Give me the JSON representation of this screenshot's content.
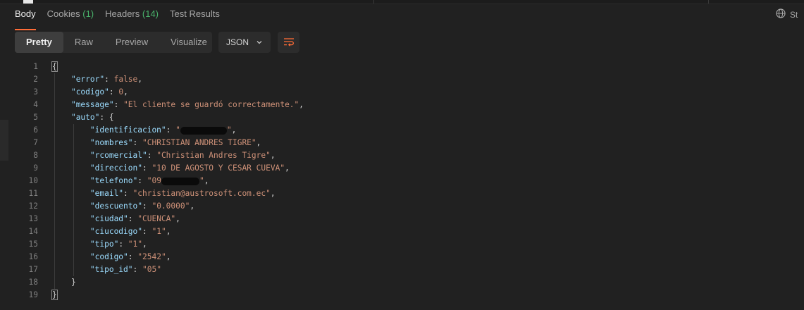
{
  "tabs": [
    {
      "label": "Body",
      "count": "",
      "active": true
    },
    {
      "label": "Cookies",
      "count": "(1)",
      "active": false
    },
    {
      "label": "Headers",
      "count": "(14)",
      "active": false
    },
    {
      "label": "Test Results",
      "count": "",
      "active": false
    }
  ],
  "status_label": "St",
  "view_modes": [
    "Pretty",
    "Raw",
    "Preview",
    "Visualize"
  ],
  "format": "JSON",
  "colors": {
    "accent": "#ff6c37",
    "count": "#49b36b",
    "key": "#9cdcfe",
    "string": "#ce9178"
  },
  "code": {
    "open_brace": "{",
    "close_brace": "}",
    "error": {
      "key": "\"error\"",
      "value": "false"
    },
    "codigo": {
      "key": "\"codigo\"",
      "value": "0"
    },
    "message": {
      "key": "\"message\"",
      "value": "\"El cliente se guardó correctamente.\""
    },
    "auto": {
      "key": "\"auto\"",
      "open": "{",
      "close": "}"
    },
    "fields": {
      "identificacion": {
        "key": "\"identificacion\"",
        "value_start": "\"",
        "value_end": "\""
      },
      "nombres": {
        "key": "\"nombres\"",
        "value": "\"CHRISTIAN ANDRES TIGRE\""
      },
      "rcomercial": {
        "key": "\"rcomercial\"",
        "value": "\"Christian Andres Tigre\""
      },
      "direccion": {
        "key": "\"direccion\"",
        "value": "\"10 DE AGOSTO Y CESAR CUEVA\""
      },
      "telefono": {
        "key": "\"telefono\"",
        "value_start": "\"09",
        "value_end": "\""
      },
      "email": {
        "key": "\"email\"",
        "value": "\"christian@austrosoft.com.ec\""
      },
      "descuento": {
        "key": "\"descuento\"",
        "value": "\"0.0000\""
      },
      "ciudad": {
        "key": "\"ciudad\"",
        "value": "\"CUENCA\""
      },
      "ciucodigo": {
        "key": "\"ciucodigo\"",
        "value": "\"1\""
      },
      "tipo": {
        "key": "\"tipo\"",
        "value": "\"1\""
      },
      "codigo": {
        "key": "\"codigo\"",
        "value": "\"2542\""
      },
      "tipo_id": {
        "key": "\"tipo_id\"",
        "value": "\"05\""
      }
    },
    "line_numbers": [
      "1",
      "2",
      "3",
      "4",
      "5",
      "6",
      "7",
      "8",
      "9",
      "10",
      "11",
      "12",
      "13",
      "14",
      "15",
      "16",
      "17",
      "18",
      "19"
    ]
  }
}
